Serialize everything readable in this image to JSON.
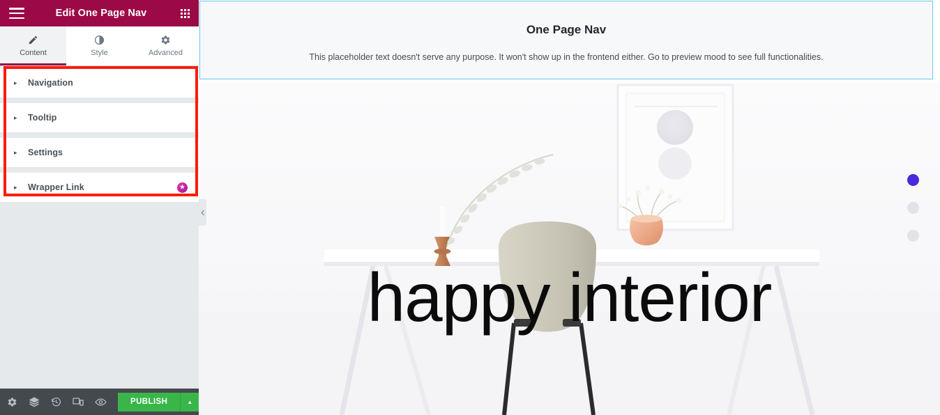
{
  "panel": {
    "header": {
      "title": "Edit One Page Nav",
      "menu_icon": "hamburger-icon",
      "apps_icon": "grid-apps-icon"
    },
    "tabs": [
      {
        "label": "Content",
        "icon": "pencil-icon",
        "active": true
      },
      {
        "label": "Style",
        "icon": "contrast-half-circle-icon",
        "active": false
      },
      {
        "label": "Advanced",
        "icon": "gear-icon",
        "active": false
      }
    ],
    "sections": [
      {
        "label": "Navigation",
        "arrow": "▸",
        "pro": false,
        "badge": ""
      },
      {
        "label": "Tooltip",
        "arrow": "▸",
        "pro": false,
        "badge": ""
      },
      {
        "label": "Settings",
        "arrow": "▸",
        "pro": false,
        "badge": ""
      },
      {
        "label": "Wrapper Link",
        "arrow": "▸",
        "pro": true,
        "badge": "★"
      }
    ],
    "footer": {
      "icons": [
        "settings-gear-icon",
        "layers-navigator-icon",
        "history-revisions-icon",
        "responsive-mode-icon",
        "preview-eye-icon"
      ],
      "publish_label": "PUBLISH",
      "publish_caret": "▲"
    },
    "highlight_box_color": "#f91d0b"
  },
  "preview": {
    "collapse_handle_icon": "chevron-left-icon",
    "hero": {
      "title": "One Page Nav",
      "subtitle": "This placeholder text doesn't serve any purpose. It won't show up in the frontend either. Go to preview mood to see full functionalities."
    },
    "selection_border_color": "#69c7f0",
    "overlay_text": "happy interior",
    "nav_dots": [
      {
        "active": true
      },
      {
        "active": false
      },
      {
        "active": false
      }
    ],
    "dot_active_color": "#4a29dc",
    "dot_inactive_color": "#e2e3e8",
    "photo_alt": "minimal white interior with desk, chair, framed art, plant and candle holder"
  },
  "colors": {
    "brand_maroon": "#9b0a46",
    "publish_green": "#39b54a",
    "footer_dark": "#44494d",
    "panel_bg": "#e6e9ec"
  }
}
